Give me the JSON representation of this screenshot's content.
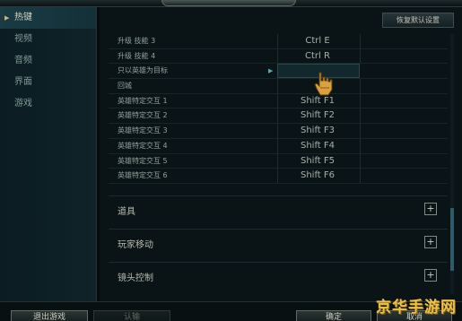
{
  "sidebar": {
    "items": [
      {
        "label": "热键",
        "active": true
      },
      {
        "label": "视频",
        "active": false
      },
      {
        "label": "音频",
        "active": false
      },
      {
        "label": "界面",
        "active": false
      },
      {
        "label": "游戏",
        "active": false
      }
    ]
  },
  "header": {
    "reset_label": "恢复默认设置"
  },
  "hotkeys": [
    {
      "action": "升级 技能 3",
      "key": "Ctrl  E"
    },
    {
      "action": "升级 技能 4",
      "key": "Ctrl  R"
    },
    {
      "action": "只以英雄为目标",
      "key": ""
    },
    {
      "action": "回城",
      "key": ""
    },
    {
      "action": "英雄特定交互 1",
      "key": "Shift  F1"
    },
    {
      "action": "英雄特定交互 2",
      "key": "Shift  F2"
    },
    {
      "action": "英雄特定交互 3",
      "key": "Shift  F3"
    },
    {
      "action": "英雄特定交互 4",
      "key": "Shift  F4"
    },
    {
      "action": "英雄特定交互 5",
      "key": "Shift  F5"
    },
    {
      "action": "英雄特定交互 6",
      "key": "Shift  F6"
    }
  ],
  "sections": [
    {
      "label": "道具",
      "toggle": "+"
    },
    {
      "label": "玩家移动",
      "toggle": "+"
    },
    {
      "label": "镜头控制",
      "toggle": "+"
    }
  ],
  "footer": {
    "exit_label": "退出游戏",
    "afk_label": "认输",
    "confirm_label": "确定",
    "cancel_label": "取消"
  },
  "watermark": "京华手游网",
  "colors": {
    "accent": "#e8c04a",
    "panel": "#0a1416",
    "sidebar_active": "#1a3b44"
  }
}
